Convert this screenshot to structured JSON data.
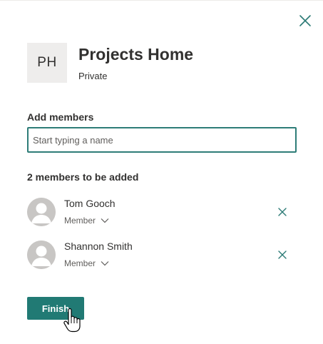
{
  "panel": {
    "close_icon": "close-icon"
  },
  "site": {
    "initials": "PH",
    "title": "Projects Home",
    "privacy": "Private"
  },
  "add_members": {
    "label": "Add members",
    "placeholder": "Start typing a name",
    "value": ""
  },
  "members": {
    "count_label": "2 members to be added",
    "items": [
      {
        "name": "Tom Gooch",
        "role": "Member"
      },
      {
        "name": "Shannon Smith",
        "role": "Member"
      }
    ]
  },
  "actions": {
    "finish_label": "Finish"
  },
  "colors": {
    "accent": "#217a74",
    "focus_border": "#2e7d78",
    "text": "#323130",
    "secondary_text": "#605e5c",
    "logo_bg": "#eeedec",
    "avatar_bg": "#c8c6c4"
  },
  "cursor": "hand-pointer-icon"
}
